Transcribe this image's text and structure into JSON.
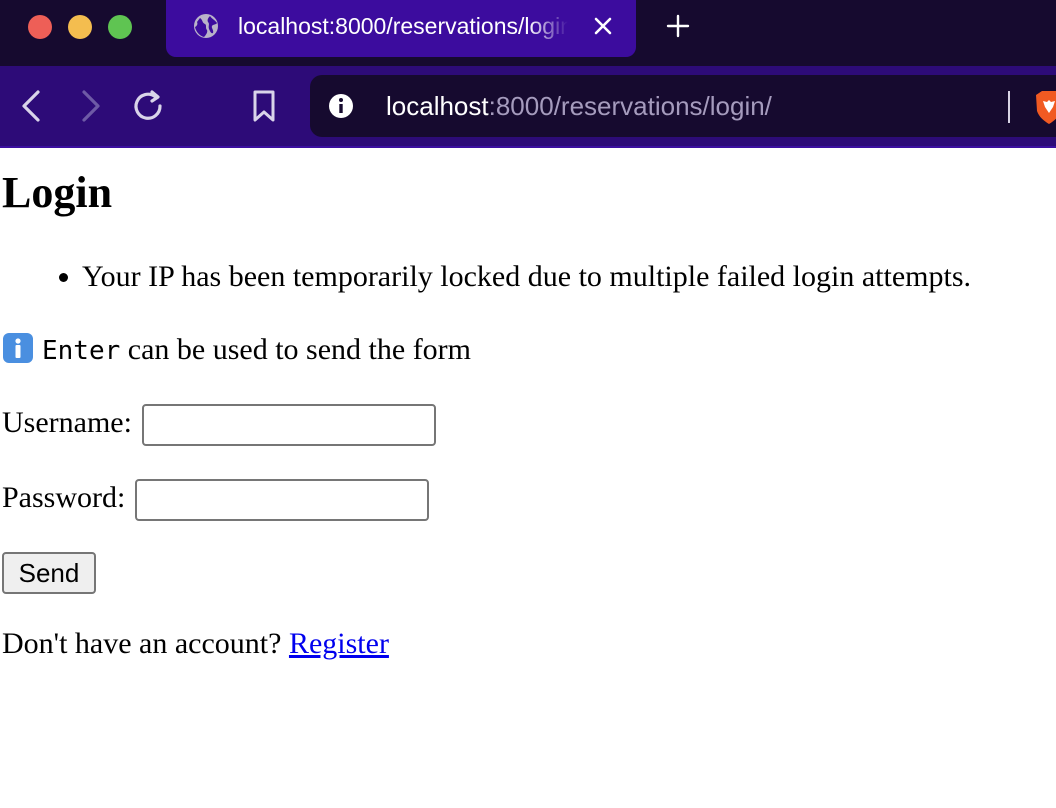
{
  "browser": {
    "tab_title": "localhost:8000/reservations/login/",
    "url_host": "localhost",
    "url_rest": ":8000/reservations/login/",
    "theme_colors": {
      "tabbar": "#160a2f",
      "tab": "#3c0c9e",
      "toolbar": "#2d0b78"
    }
  },
  "page": {
    "title": "Login",
    "messages": [
      "Your IP has been temporarily locked due to multiple failed login attempts."
    ],
    "hint_key": "Enter",
    "hint_text": " can be used to send the form",
    "username_label": "Username:",
    "username_value": "",
    "password_label": "Password:",
    "password_value": "",
    "send_label": "Send",
    "register_prompt": "Don't have an account? ",
    "register_link": "Register"
  }
}
